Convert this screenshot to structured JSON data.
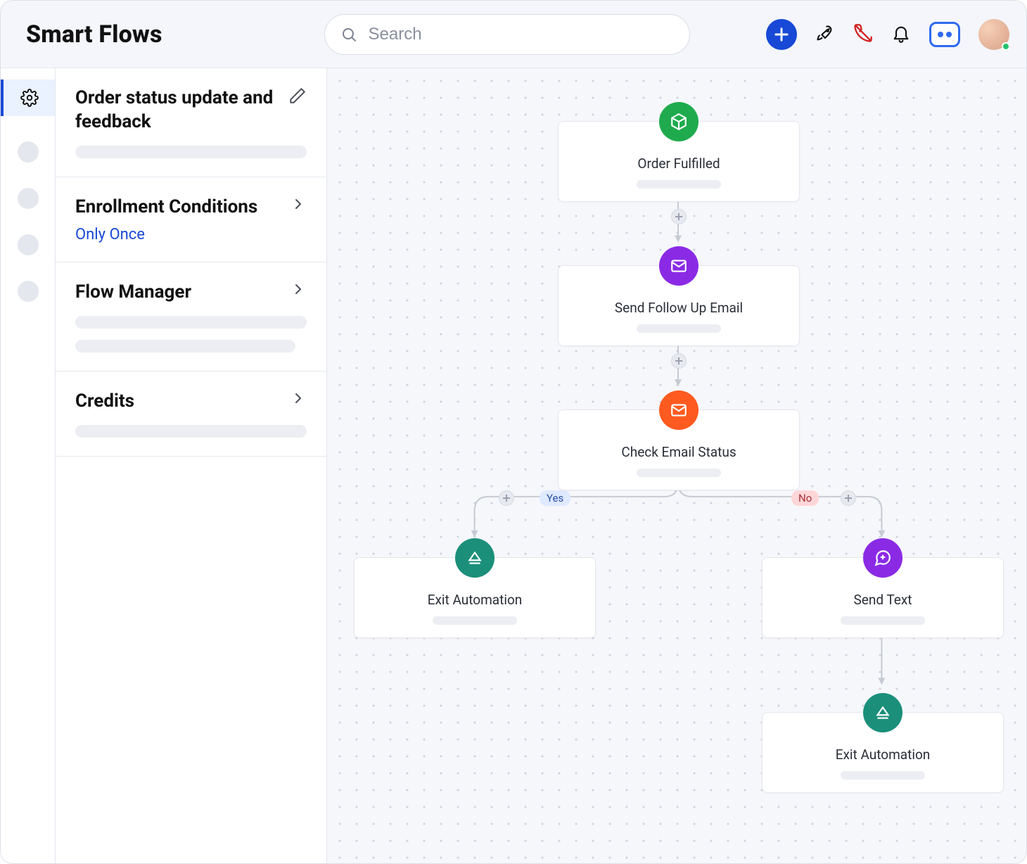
{
  "header": {
    "title": "Smart Flows",
    "search_placeholder": "Search"
  },
  "rail": {
    "active_icon": "settings-icon"
  },
  "sidebar": {
    "flow_name": "Order status update and feedback",
    "sections": [
      {
        "title": "Enrollment Conditions",
        "subtitle": "Only Once",
        "expandable": true
      },
      {
        "title": "Flow Manager",
        "expandable": true
      },
      {
        "title": "Credits",
        "expandable": true
      }
    ]
  },
  "flow": {
    "nodes": {
      "order_fulfilled": {
        "label": "Order Fulfilled",
        "icon": "cube-icon",
        "color": "#1fab4d"
      },
      "send_followup": {
        "label": "Send Follow Up Email",
        "icon": "mail-icon",
        "color": "#8b2ae5"
      },
      "check_email_status": {
        "label": "Check Email Status",
        "icon": "mail-icon",
        "color": "#ff5a1f"
      },
      "exit_yes": {
        "label": "Exit Automation",
        "icon": "eject-icon",
        "color": "#1b8f7a"
      },
      "send_text": {
        "label": "Send Text",
        "icon": "chat-icon",
        "color": "#8b2ae5"
      },
      "exit_no": {
        "label": "Exit Automation",
        "icon": "eject-icon",
        "color": "#1b8f7a"
      }
    },
    "branches": {
      "yes_label": "Yes",
      "no_label": "No"
    }
  }
}
